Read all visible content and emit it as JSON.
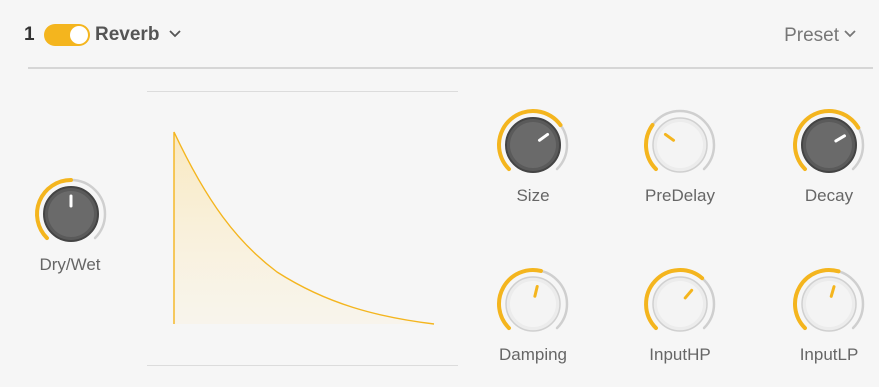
{
  "header": {
    "slot_number": "1",
    "enabled": true,
    "title": "Reverb",
    "preset_label": "Preset"
  },
  "icons": {
    "title_chevron": "chevron-down-icon",
    "preset_chevron": "chevron-down-icon"
  },
  "colors": {
    "accent": "#f4b51e",
    "track": "#cfcfcf",
    "dark_knob": "#5a5a5a",
    "light_knob": "#ececec",
    "background": "#f6f6f6"
  },
  "knobs": {
    "dry_wet": {
      "label": "Dry/Wet",
      "value": 0.5,
      "style": "dark"
    },
    "size": {
      "label": "Size",
      "value": 0.7,
      "style": "dark"
    },
    "predelay": {
      "label": "PreDelay",
      "value": 0.3,
      "style": "light"
    },
    "decay": {
      "label": "Decay",
      "value": 0.72,
      "style": "dark"
    },
    "damping": {
      "label": "Damping",
      "value": 0.55,
      "style": "light"
    },
    "input_hp": {
      "label": "InputHP",
      "value": 0.65,
      "style": "light"
    },
    "input_lp": {
      "label": "InputLP",
      "value": 0.56,
      "style": "light"
    }
  }
}
